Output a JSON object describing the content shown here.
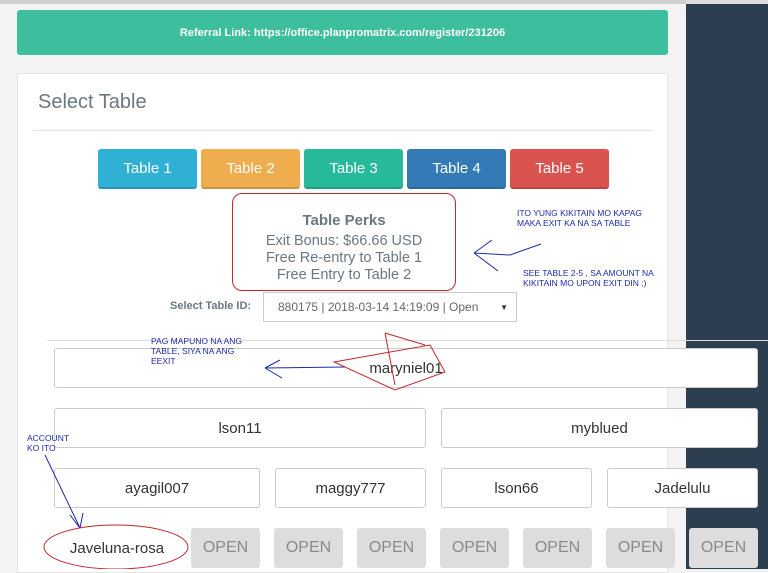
{
  "referral_link": "Referral Link: https://office.planpromatrix.com/register/231206",
  "panel_title": "Select Table",
  "tables": [
    {
      "label": "Table 1",
      "color": "#31b0d5"
    },
    {
      "label": "Table 2",
      "color": "#f0ad4e"
    },
    {
      "label": "Table 3",
      "color": "#26b99a"
    },
    {
      "label": "Table 4",
      "color": "#337ab7"
    },
    {
      "label": "Table 5",
      "color": "#d9534f"
    }
  ],
  "perks": {
    "title": "Table Perks",
    "lines": [
      "Exit Bonus: $66.66 USD",
      "Free Re-entry to Table 1",
      "Free Entry to Table 2"
    ]
  },
  "select": {
    "label": "Select Table ID:",
    "value": "880175 | 2018-03-14 14:19:09 | Open"
  },
  "slots": {
    "row1": [
      "maryniel01"
    ],
    "row2": [
      "lson11",
      "myblued"
    ],
    "row3": [
      "ayagil007",
      "maggy777",
      "lson66",
      "Jadelulu"
    ],
    "row4": [
      "Javeluna-rosa",
      "OPEN",
      "OPEN",
      "OPEN",
      "OPEN",
      "OPEN",
      "OPEN",
      "OPEN"
    ]
  },
  "annotations": {
    "exit": "ITO YUNG KIKITAIN MO KAPAG MAKA EXIT KA NA SA TABLE",
    "see": "SEE TABLE 2-5 , SA AMOUNT NA KIKITAIN MO UPON EXIT DIN :)",
    "full": "PAG MAPUNO NA ANG TABLE, SIYA NA ANG EEXIT",
    "account": "ACCOUNT KO ITO"
  }
}
